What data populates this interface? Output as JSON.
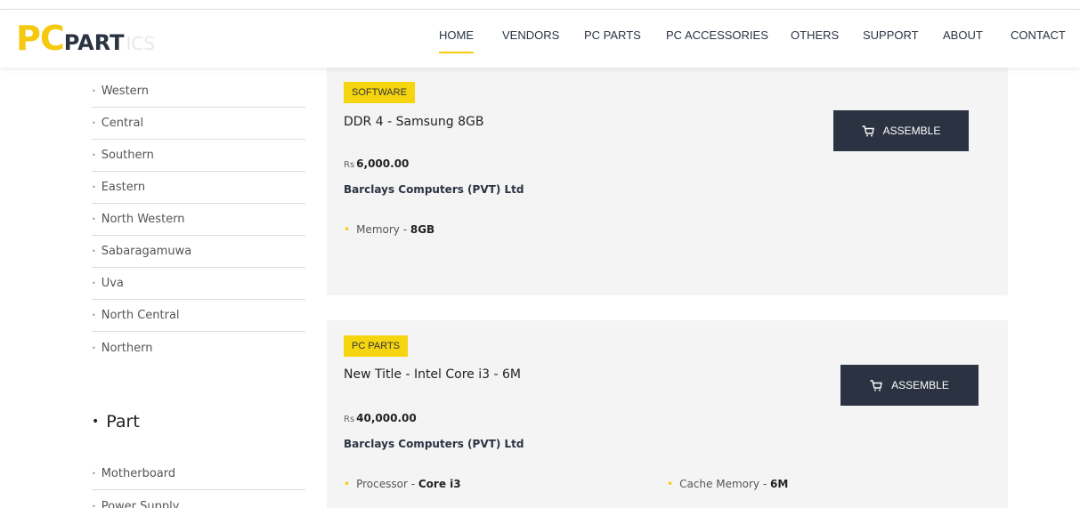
{
  "header": {
    "logo": {
      "pc": "PC",
      "part": "PART",
      "ghost": "ICS"
    },
    "nav": [
      {
        "label": "HOME",
        "active": true
      },
      {
        "label": "VENDORS"
      },
      {
        "label": "PC PARTS"
      },
      {
        "label": "PC ACCESSORIES"
      },
      {
        "label": "OTHERS"
      },
      {
        "label": "SUPPORT"
      },
      {
        "label": "ABOUT"
      },
      {
        "label": "CONTACT"
      }
    ]
  },
  "sidebar": {
    "provinces": [
      "Western",
      "Central",
      "Southern",
      "Eastern",
      "North Western",
      "Sabaragamuwa",
      "Uva",
      "North Central",
      "Northern"
    ],
    "part_heading": "Part",
    "parts": [
      "Motherboard",
      "Power Supply"
    ]
  },
  "products": [
    {
      "badge": "SOFTWARE",
      "title": "DDR 4 - Samsung 8GB",
      "currency": "Rs",
      "price": "6,000.00",
      "vendor": "Barclays Computers (PVT) Ltd",
      "specs": [
        {
          "name": "Memory - ",
          "value": "8GB"
        }
      ],
      "button": "ASSEMBLE"
    },
    {
      "badge": "PC PARTS",
      "title": "New Title - Intel Core i3 - 6M",
      "currency": "Rs",
      "price": "40,000.00",
      "vendor": "Barclays Computers (PVT) Ltd",
      "specs": [
        {
          "name": "Processor - ",
          "value": "Core i3"
        },
        {
          "name": "Cache Memory - ",
          "value": "6M"
        }
      ],
      "button": "ASSEMBLE"
    }
  ],
  "colors": {
    "accent": "#f5c90f",
    "dark": "#2b3343",
    "card_bg": "#f4f4f4"
  },
  "icons": {
    "assemble": "cart-icon"
  }
}
